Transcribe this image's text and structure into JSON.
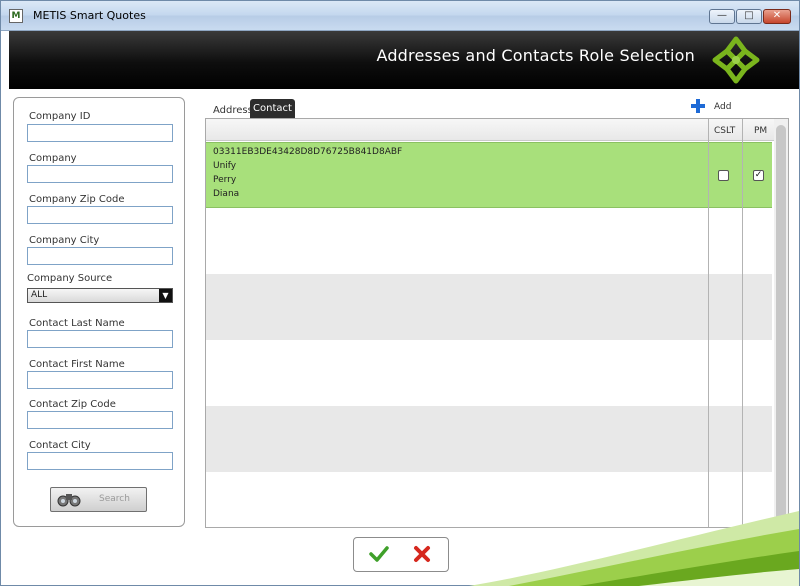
{
  "window": {
    "title": "METIS Smart Quotes",
    "buttons": {
      "minimize": "—",
      "maximize": "□",
      "close": "✕"
    }
  },
  "header": {
    "title": "Addresses and Contacts Role Selection",
    "logo_icon": "metis-logo-icon"
  },
  "search_panel": {
    "company_id_label": "Company ID",
    "company_id_value": "",
    "company_label": "Company",
    "company_value": "",
    "company_zip_label": "Company Zip Code",
    "company_zip_value": "",
    "company_city_label": "Company City",
    "company_city_value": "",
    "company_source_label": "Company Source",
    "company_source_selected": "ALL",
    "contact_last_name_label": "Contact Last Name",
    "contact_last_name_value": "",
    "contact_first_name_label": "Contact First Name",
    "contact_first_name_value": "",
    "contact_zip_label": "Contact Zip Code",
    "contact_zip_value": "",
    "contact_city_label": "Contact City",
    "contact_city_value": "",
    "search_button_label": "Search",
    "search_button_icon": "binoculars-icon"
  },
  "tabs": {
    "address_label": "Address",
    "contact_label": "Contact",
    "active": "Contact"
  },
  "add_button": {
    "label": "Add",
    "icon": "plus-icon"
  },
  "grid": {
    "columns": {
      "cslt": "CSLT",
      "pm": "PM"
    },
    "rows": [
      {
        "id": "03311EB3DE43428D8D76725B841D8ABF",
        "company": "Unify",
        "last_name": "Perry",
        "first_name": "Diana",
        "cslt_checked": false,
        "pm_checked": true,
        "selected": true
      }
    ]
  },
  "actions": {
    "ok_icon": "checkmark-icon",
    "cancel_icon": "red-x-icon"
  },
  "colors": {
    "selected_row": "#a8e07b",
    "header_band": "#000000",
    "accent_green": "#7ab51d",
    "tab_active_bg": "#2d2d2d"
  }
}
